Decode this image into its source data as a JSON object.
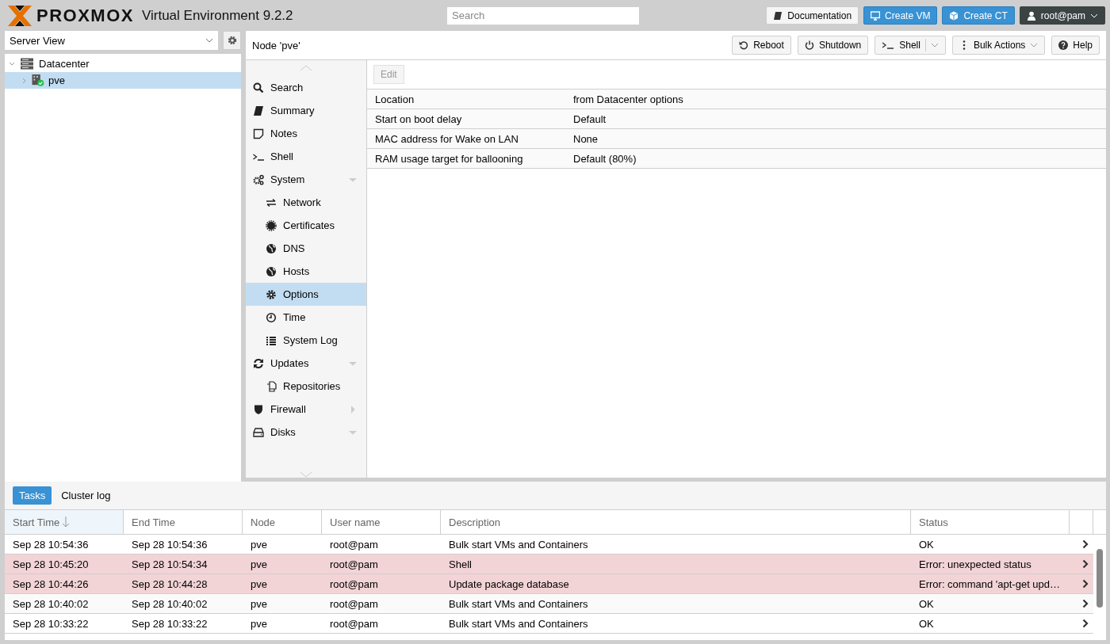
{
  "header": {
    "brand": "PROXMOX",
    "product": "Virtual Environment 9.2.2",
    "search": {
      "placeholder": "Search"
    },
    "buttons": [
      {
        "label": "Documentation",
        "kind": "plain"
      },
      {
        "label": "Create VM",
        "kind": "primary"
      },
      {
        "label": "Create CT",
        "kind": "primary"
      },
      {
        "label": "root@pam",
        "kind": "user"
      }
    ]
  },
  "resource_tree": {
    "view_select": {
      "value": "Server View"
    },
    "items": [
      {
        "label": "Datacenter",
        "expanded": true,
        "selected": false,
        "children": [
          {
            "label": "pve",
            "expanded": false,
            "selected": true,
            "online": true
          }
        ]
      }
    ]
  },
  "node_panel": {
    "title": "Node 'pve'",
    "toolbar": [
      {
        "label": "Reboot",
        "kind": "plain"
      },
      {
        "label": "Shutdown",
        "kind": "plain"
      },
      {
        "label": "Shell",
        "kind": "split"
      },
      {
        "label": "Bulk Actions",
        "kind": "menu"
      },
      {
        "label": "Help",
        "kind": "plain"
      }
    ],
    "nav": [
      {
        "label": "Search",
        "selected": false
      },
      {
        "label": "Summary",
        "selected": false
      },
      {
        "label": "Notes",
        "selected": false
      },
      {
        "label": "Shell",
        "selected": false
      },
      {
        "label": "System",
        "selected": false,
        "expanded": true,
        "children": [
          {
            "label": "Network",
            "selected": false
          },
          {
            "label": "Certificates",
            "selected": false
          },
          {
            "label": "DNS",
            "selected": false
          },
          {
            "label": "Hosts",
            "selected": false
          },
          {
            "label": "Options",
            "selected": true
          },
          {
            "label": "Time",
            "selected": false
          },
          {
            "label": "System Log",
            "selected": false
          }
        ]
      },
      {
        "label": "Updates",
        "selected": false,
        "expanded": true,
        "children": [
          {
            "label": "Repositories",
            "selected": false
          }
        ]
      },
      {
        "label": "Firewall",
        "selected": false,
        "expanded": false
      },
      {
        "label": "Disks",
        "selected": false,
        "expanded": true
      }
    ],
    "edit_button": {
      "label": "Edit",
      "disabled": true
    },
    "options": [
      {
        "name": "Location",
        "value": "from Datacenter options"
      },
      {
        "name": "Start on boot delay",
        "value": "Default"
      },
      {
        "name": "MAC address for Wake on LAN",
        "value": "None"
      },
      {
        "name": "RAM usage target for ballooning",
        "value": "Default (80%)"
      }
    ]
  },
  "log_panel": {
    "tabs": [
      {
        "label": "Tasks",
        "selected": true
      },
      {
        "label": "Cluster log",
        "selected": false
      }
    ],
    "columns": [
      {
        "label": "Start Time",
        "sorted": true
      },
      {
        "label": "End Time",
        "sorted": false
      },
      {
        "label": "Node",
        "sorted": false
      },
      {
        "label": "User name",
        "sorted": false
      },
      {
        "label": "Description",
        "sorted": false
      },
      {
        "label": "Status",
        "sorted": false
      }
    ],
    "rows": [
      {
        "start": "Sep 28 10:54:36",
        "end": "Sep 28 10:54:36",
        "node": "pve",
        "user": "root@pam",
        "description": "Bulk start VMs and Containers",
        "status": "OK",
        "error": false
      },
      {
        "start": "Sep 28 10:45:20",
        "end": "Sep 28 10:54:34",
        "node": "pve",
        "user": "root@pam",
        "description": "Shell",
        "status": "Error: unexpected status",
        "error": true
      },
      {
        "start": "Sep 28 10:44:26",
        "end": "Sep 28 10:44:28",
        "node": "pve",
        "user": "root@pam",
        "description": "Update package database",
        "status": "Error: command 'apt-get upd…",
        "error": true
      },
      {
        "start": "Sep 28 10:40:02",
        "end": "Sep 28 10:40:02",
        "node": "pve",
        "user": "root@pam",
        "description": "Bulk start VMs and Containers",
        "status": "OK",
        "error": false
      },
      {
        "start": "Sep 28 10:33:22",
        "end": "Sep 28 10:33:22",
        "node": "pve",
        "user": "root@pam",
        "description": "Bulk start VMs and Containers",
        "status": "OK",
        "error": false
      }
    ]
  }
}
